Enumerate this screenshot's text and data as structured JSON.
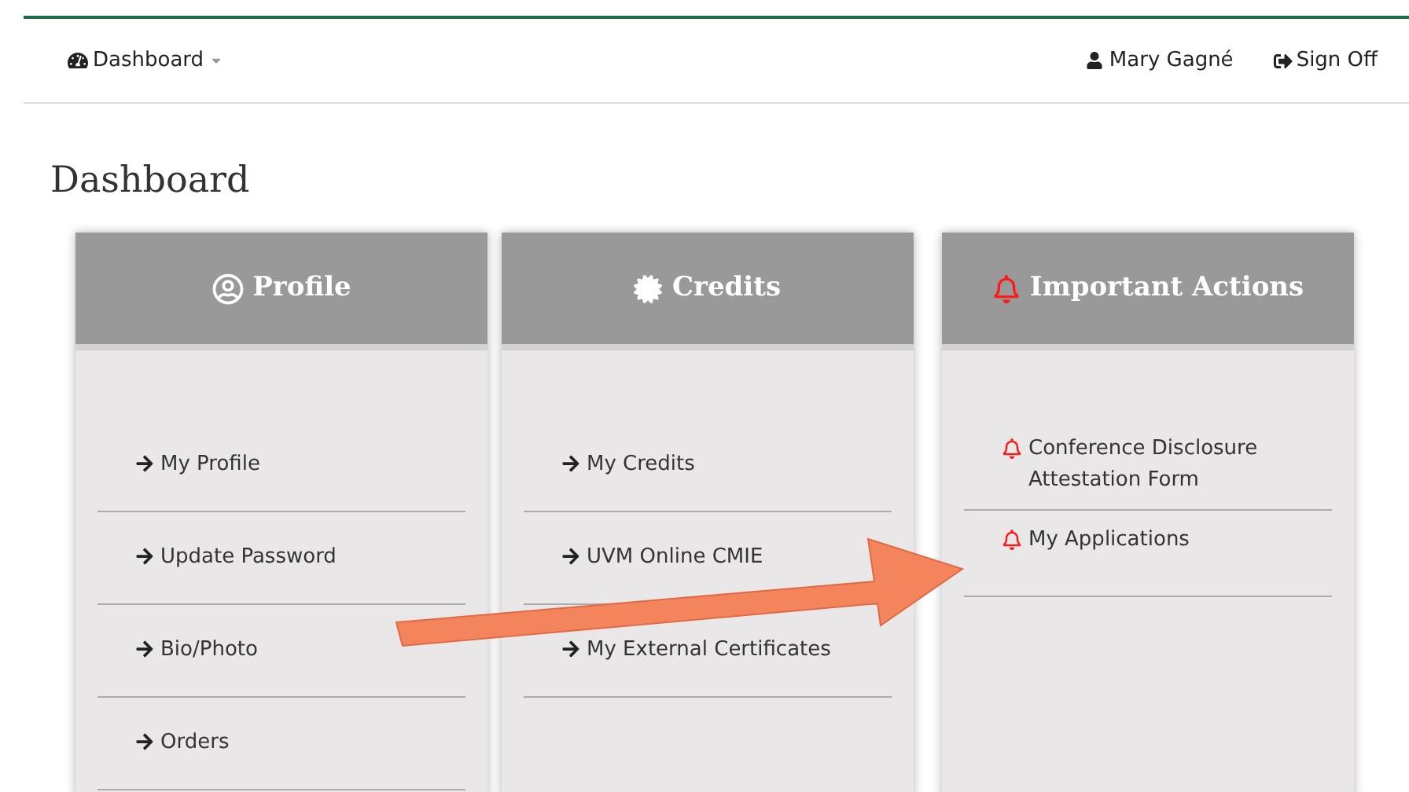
{
  "navbar": {
    "menu": "Dashboard",
    "user": "Mary Gagné",
    "sign_off": "Sign Off"
  },
  "page_title": "Dashboard",
  "cards": [
    {
      "kind": "profile",
      "title": "Profile",
      "items": [
        "My Profile",
        "Update Password",
        "Bio/Photo",
        "Orders"
      ]
    },
    {
      "kind": "credits",
      "title": "Credits",
      "items": [
        "My Credits",
        "UVM Online CMIE",
        "My External Certificates"
      ]
    },
    {
      "kind": "actions",
      "title": "Important Actions",
      "items": [
        "Conference Disclosure Attestation Form",
        "My Applications"
      ]
    }
  ]
}
